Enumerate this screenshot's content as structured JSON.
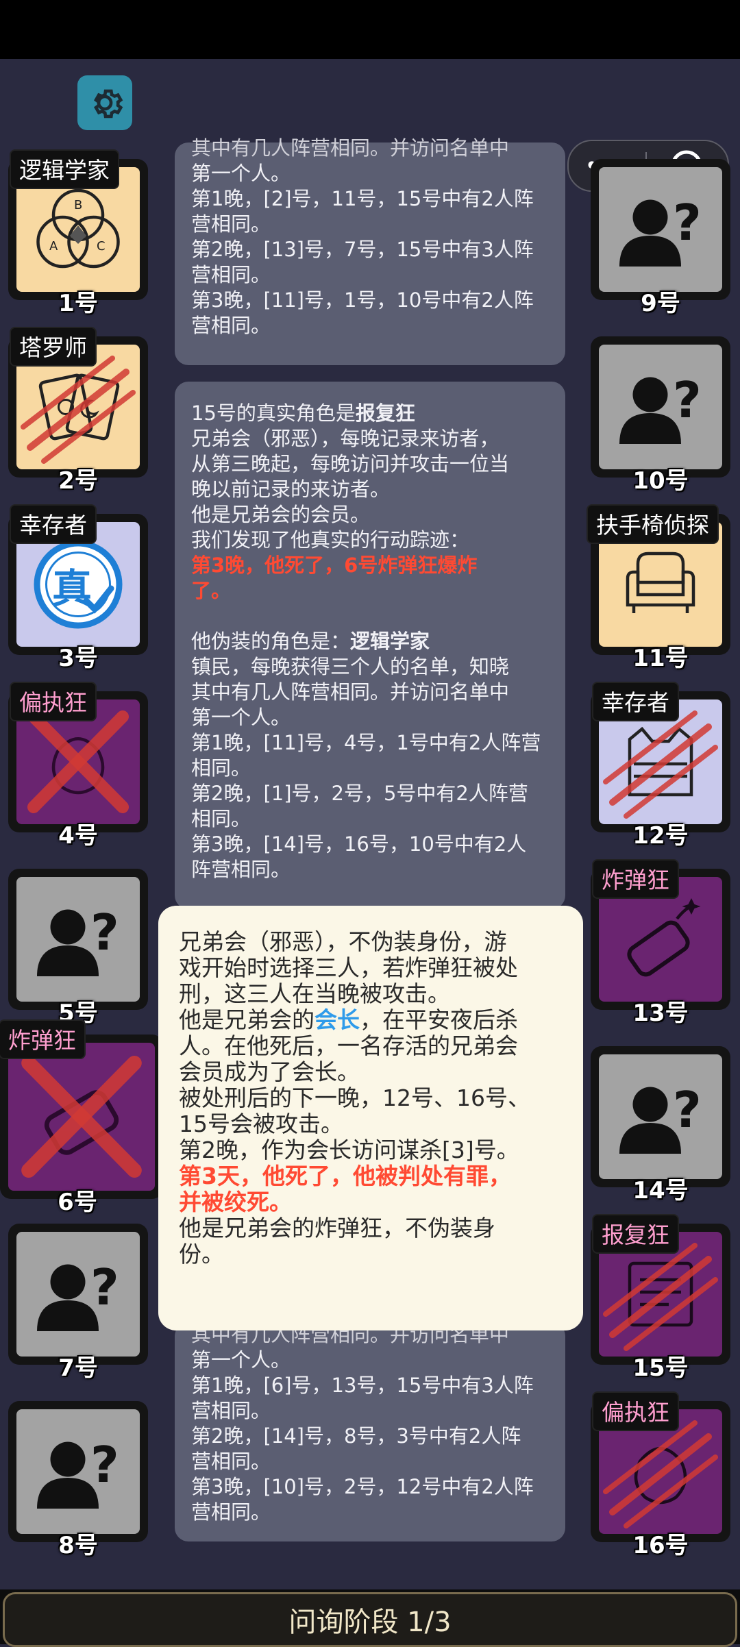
{
  "phase_label": "问询阶段 1/3",
  "capsule": {
    "more": "•••"
  },
  "left_cards": [
    {
      "role": "逻辑学家",
      "num": "1号"
    },
    {
      "role": "塔罗师",
      "num": "2号"
    },
    {
      "role": "幸存者",
      "num": "3号",
      "stamp": "真"
    },
    {
      "role": "偏执狂",
      "num": "4号"
    },
    {
      "role": "",
      "num": "5号"
    },
    {
      "role": "炸弹狂",
      "num": "6号"
    },
    {
      "role": "",
      "num": "7号"
    },
    {
      "role": "",
      "num": "8号"
    }
  ],
  "right_cards": [
    {
      "role": "",
      "num": "9号"
    },
    {
      "role": "",
      "num": "10号"
    },
    {
      "role": "扶手椅侦探",
      "num": "11号"
    },
    {
      "role": "幸存者",
      "num": "12号"
    },
    {
      "role": "炸弹狂",
      "num": "13号"
    },
    {
      "role": "",
      "num": "14号"
    },
    {
      "role": "报复狂",
      "num": "15号"
    },
    {
      "role": "偏执狂",
      "num": "16号"
    }
  ],
  "log1": {
    "cut": "其中有几人阵营相同。并访问名单中",
    "lines": [
      "第一个人。",
      "第1晚，[2]号，11号，15号中有2人阵",
      "营相同。",
      "第2晚，[13]号，7号，15号中有3人阵",
      "营相同。",
      "第3晚，[11]号，1号，10号中有2人阵",
      "营相同。"
    ]
  },
  "log2": {
    "title_pre": "15号的真实角色是",
    "title_role": "报复狂",
    "desc": [
      "兄弟会（邪恶），每晚记录来访者，",
      "从第三晚起，每晚访问并攻击一位当",
      "晚以前记录的来访者。",
      "他是兄弟会的会员。",
      "我们发现了他真实的行动踪迹："
    ],
    "red": [
      "第3晚，他死了，6号炸弹狂爆炸",
      "了。"
    ],
    "fake_pre": "他伪装的角色是：",
    "fake_role": "逻辑学家",
    "fake_lines": [
      "镇民，每晚获得三个人的名单，知晓",
      "其中有几人阵营相同。并访问名单中",
      "第一个人。",
      "第1晚，[11]号，4号，1号中有2人阵营",
      "相同。",
      "第2晚，[1]号，2号，5号中有2人阵营",
      "相同。",
      "第3晚，[14]号，16号，10号中有2人",
      "阵营相同。"
    ]
  },
  "log3": {
    "cut": "其中有几人阵营相同。并访问名单中",
    "lines": [
      "第一个人。",
      "第1晚，[6]号，13号，15号中有3人阵",
      "营相同。",
      "第2晚，[14]号，8号，3号中有2人阵",
      "营相同。",
      "第3晚，[10]号，2号，12号中有2人阵",
      "营相同。"
    ]
  },
  "tooltip": {
    "l1": "兄弟会（邪恶），不伪装身份，游",
    "l2": "戏开始时选择三人，若炸弹狂被处",
    "l3": "刑，这三人在当晚被攻击。",
    "l4_pre": "他是兄弟会的",
    "l4_hl": "会长",
    "l4_post": "，在平安夜后杀",
    "l5": "人。在他死后，一名存活的兄弟会",
    "l6": "会员成为了会长。",
    "l7": "被处刑后的下一晚，12号、16号、",
    "l8": "15号会被攻击。",
    "l9": "第2晚，作为会长访问谋杀[3]号。",
    "r1": "第3天，他死了，他被判处有罪，",
    "r2": "并被绞死。",
    "l10": "他是兄弟会的炸弹狂，不伪装身",
    "l11": "份。"
  }
}
